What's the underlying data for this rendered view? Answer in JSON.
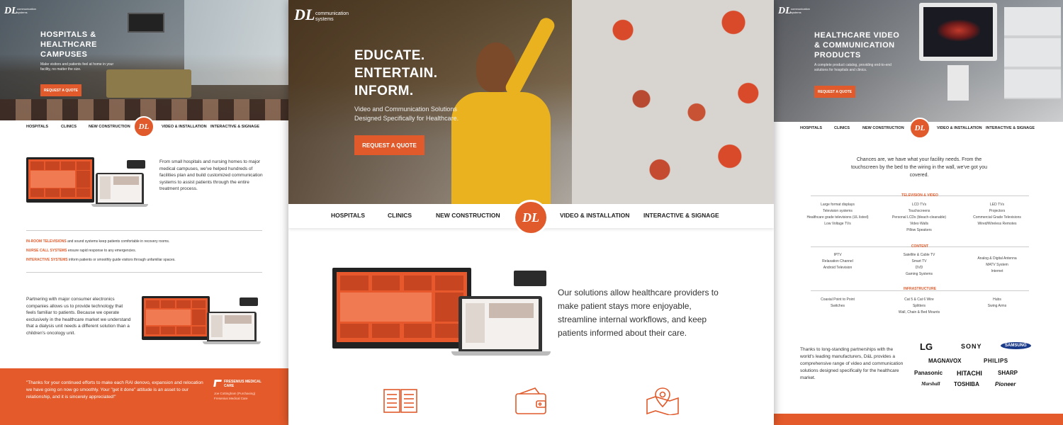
{
  "logo": {
    "letters": "DL",
    "tagline": "communication systems"
  },
  "nav": {
    "hospitals": "Hospitals",
    "clinics": "Clinics",
    "new_construction": "New Construction",
    "video_installation": "Video & Installation",
    "interactive_signage": "Interactive & Signage",
    "badge": "DL"
  },
  "left": {
    "hero_title": "Hospitals & Healthcare Campuses",
    "hero_sub": "Make visitors and patients feel at home in your facility, no matter the size.",
    "cta": "Request a Quote",
    "intro": "From small hospitals and nursing homes to major medical campuses, we've helped hundreds of facilities plan and build customized communication systems to assist patients through the entire treatment process.",
    "features": [
      {
        "label": "In-Room Televisions",
        "text": "and sound systems keep patients comfortable in recovery rooms."
      },
      {
        "label": "Nurse Call Systems",
        "text": "ensure rapid response to any emergencies."
      },
      {
        "label": "Interactive Systems",
        "text": "inform patients or smoothly guide visitors through unfamiliar spaces."
      }
    ],
    "partner_text": "Partnering with major consumer electronics companies allows us to provide technology that feels familiar to patients. Because we operate exclusively in the healthcare market we understand that a dialysis unit needs a different solution than a children's oncology unit.",
    "quote": "\"Thanks for your continued efforts to make each RAI denovo, expansion and relocation we have going on now go smoothly. Your \"get it done\" attitude is an asset to our relationship, and it is sincerely appreciated!\"",
    "quote_logo": "Fresenius Medical Care",
    "quote_author": "Joe Cottingham (Purchasing)",
    "quote_company": "Fresenius Medical Care"
  },
  "center": {
    "hero_title": [
      "Educate.",
      "Entertain.",
      "Inform."
    ],
    "hero_sub": "Video and Communication Solutions Designed Specifically for Healthcare.",
    "cta": "Request a Quote",
    "body": "Our solutions allow healthcare providers to make patient stays more enjoyable, streamline internal workflows, and keep patients informed about their care.",
    "icons": [
      "book-icon",
      "wallet-icon",
      "map-pin-icon"
    ]
  },
  "right": {
    "hero_title": "Healthcare Video & Communication Products",
    "hero_sub": "A complete product catalog, providing end-to-end solutions for hospitals and clinics.",
    "cta": "Request a Quote",
    "intro": "Chances are, we have what your facility needs. From the touchscreen by the bed to the wiring in the wall, we've got you covered.",
    "sections": [
      {
        "title": "Television & Video",
        "cols": [
          [
            "Large format displays",
            "Television systems",
            "Healthcare grade televisions (UL listed)",
            "Low Voltage TVs"
          ],
          [
            "LCD TVs",
            "Touchscreens",
            "Personal LCDs (bleach-cleanable)",
            "Video Walls",
            "Pillow Speakers"
          ],
          [
            "LED TVs",
            "Projectors",
            "Commercial Grade Televisions",
            "Wired/Wireless Remotes"
          ]
        ]
      },
      {
        "title": "Content",
        "cols": [
          [
            "IPTV",
            "Relaxation Channel",
            "Android Television"
          ],
          [
            "Satellite & Cable TV",
            "Smart TV",
            "DVD",
            "Gaming Systems"
          ],
          [
            "Analog & Digital Antenna",
            "MATV System",
            "Internet"
          ]
        ]
      },
      {
        "title": "Infrastructure",
        "cols": [
          [
            "Coaxial Point to Point",
            "Switches"
          ],
          [
            "Cat 5 & Cat 6 Wire",
            "Splitters",
            "Wall, Chain & Bed Mounts"
          ],
          [
            "Hubs",
            "Swing Arms"
          ]
        ]
      }
    ],
    "partners_text": "Thanks to long-standing partnerships with the world's leading manufacturers, D&L provides a comprehensive range of video and communication solutions designed specifically for the healthcare market.",
    "brands": [
      "LG",
      "SONY",
      "SAMSUNG",
      "MAGNAVOX",
      "PHILIPS",
      "Panasonic",
      "HITACHI",
      "SHARP",
      "Marshall",
      "TOSHIBA",
      "Pioneer"
    ]
  }
}
